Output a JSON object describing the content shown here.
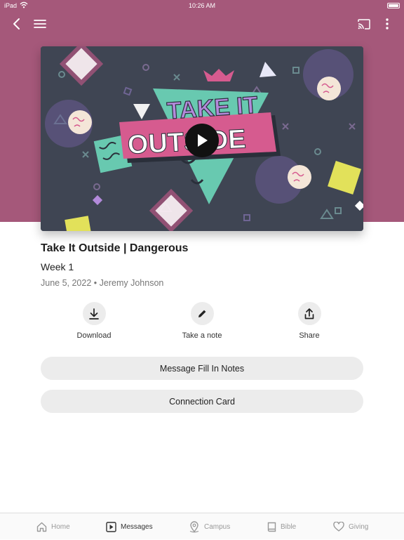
{
  "status_bar": {
    "device": "iPad",
    "time": "10:26 AM"
  },
  "colors": {
    "header": "#a5587a",
    "pill": "#ececec",
    "artwork_bg": "#3f4553",
    "artwork_pink": "#d65b8f",
    "artwork_teal": "#68c9b0"
  },
  "nav": {
    "icons": [
      "back-icon",
      "menu-icon",
      "cast-icon",
      "more-icon"
    ]
  },
  "artwork": {
    "line1": "TAKE IT",
    "line2": "OUTSIDE"
  },
  "message": {
    "title": "Take It Outside | Dangerous",
    "subtitle": "Week 1",
    "date": "June 5, 2022",
    "separator": "•",
    "speaker": "Jeremy Johnson"
  },
  "actions": [
    {
      "label": "Download",
      "icon": "download-icon"
    },
    {
      "label": "Take a note",
      "icon": "pencil-icon"
    },
    {
      "label": "Share",
      "icon": "share-icon"
    }
  ],
  "buttons": {
    "notes": "Message Fill In Notes",
    "card": "Connection Card"
  },
  "tabs": [
    {
      "label": "Home",
      "icon": "home-icon"
    },
    {
      "label": "Messages",
      "icon": "play-square-icon",
      "active": true
    },
    {
      "label": "Campus",
      "icon": "location-pin-icon"
    },
    {
      "label": "Bible",
      "icon": "book-icon"
    },
    {
      "label": "Giving",
      "icon": "heart-icon"
    }
  ]
}
